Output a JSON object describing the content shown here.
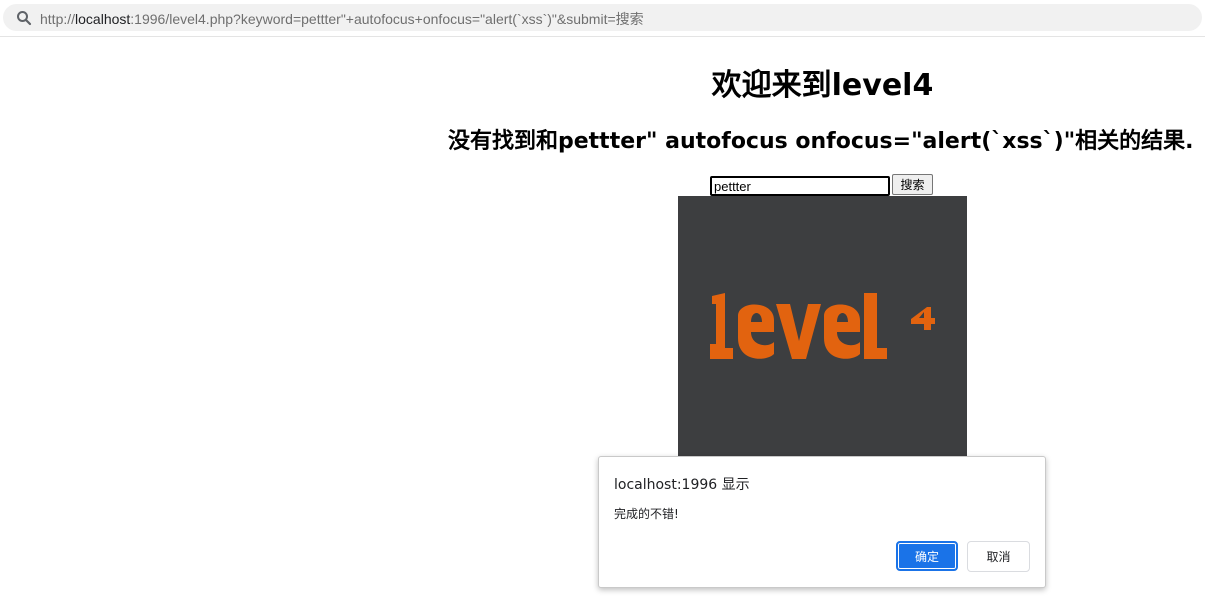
{
  "browser": {
    "url_prefix": "http://",
    "url_host": "localhost",
    "url_rest": ":1996/level4.php?keyword=pettter\"+autofocus+onfocus=\"alert(`xss`)\"&submit=搜索",
    "search_icon": "search-icon"
  },
  "page": {
    "title": "欢迎来到level4",
    "result_message": "没有找到和pettter\" autofocus onfocus=\"alert(`xss`)\"相关的结果.",
    "search": {
      "value": "pettter",
      "button_label": "搜索"
    },
    "image": {
      "logo_text": "level4",
      "background_color": "#3d3e40",
      "logo_color": "#e2630f"
    }
  },
  "dialog": {
    "title": "localhost:1996 显示",
    "message": "完成的不错!",
    "ok_label": "确定",
    "cancel_label": "取消",
    "accent_color": "#1a73e8"
  }
}
